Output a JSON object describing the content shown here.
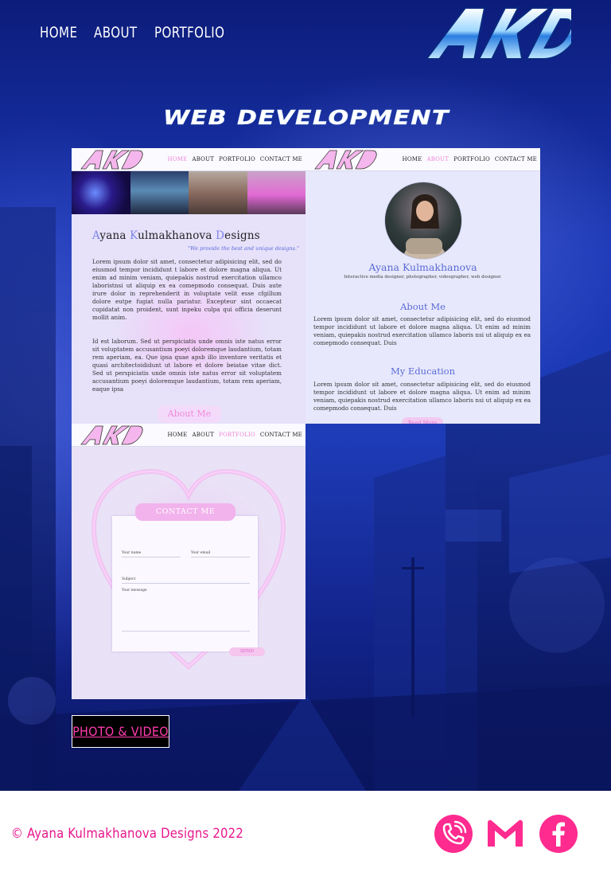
{
  "nav": {
    "items": [
      {
        "label": "HOME"
      },
      {
        "label": "ABOUT"
      },
      {
        "label": "PORTFOLIO"
      }
    ]
  },
  "logo": {
    "text": "AKD"
  },
  "section": {
    "title": "WEB DEVELOPMENT"
  },
  "thumbnails": {
    "home": {
      "nav": [
        "HOME",
        "ABOUT",
        "PORTFOLIO",
        "CONTACT ME"
      ],
      "active": "HOME",
      "title_parts": [
        "A",
        "yana ",
        "K",
        "ulmakhanova ",
        "D",
        "esigns"
      ],
      "tagline": "\"We provide the best and unique designs.\"",
      "para1": "Lorem ipsum dolor sit amet, consectetur adipisicing elit, sed do eiusmod tempor incididunt t labore et dolore magna aliqua. Ut enim ad minim veniam, quiepakis nostrud exercitation ullamco laboristnsi ut aliquip ex ea comepmodo consequat. Duis aute irure dolor in reprehenderit in voluptate velit esse cfgillum dolore eutpe fugiat nulla pariatur. Excepteur sint occaecat cupidatat non proident, sunt inpeku culpa qui officia deserunt mollit anim.",
      "para2": "Id est laborum. Sed ut perspiciatis unde omnis iste natus error sit voluptatem accusantium poeyi doloremque laudantium, totam rem aperiam, ea. Que ipsa quae apsb illo inventore veritatis et quasi architectoididunt ut labore et dolore beiatae vitae dict. Sed ut perspiciatis unde omnis iste natus error sit voluptatem accusantium poeyi doloremque laudantium, totam rem aperiam, eaque ipsa",
      "button": "About Me"
    },
    "about": {
      "nav": [
        "HOME",
        "ABOUT",
        "PORTFOLIO",
        "CONTACT ME"
      ],
      "active": "ABOUT",
      "name": "Ayana Kulmakhanova",
      "subtitle": "Interactive media designer, photographer, videographer, web designer.",
      "heading1": "About Me",
      "para1": "Lorem ipsum dolor sit amet, consectetur adipisicing elit, sed do eiusmod tempor incididunt ut labore et dolore magna aliqua. Ut enim ad minim veniam, quiepakis nostrud exercitation ullamco laboris nsi ut aliquip ex ea comepmodo consequat. Duis",
      "heading2": "My Education",
      "para2": "Lorem ipsum dolor sit amet, consectetur adipisicing elit, sed do eiusmod tempor incididunt ut labore et dolore magna aliqua. Ut enim ad minim veniam, quiepakis nostrud exercitation ullamco laboris nsi ut aliquip ex ea comepmodo consequat. Duis",
      "button": "Read More"
    },
    "contact": {
      "nav": [
        "HOME",
        "ABOUT",
        "PORTFOLIO",
        "CONTACT ME"
      ],
      "active": "PORTFOLIO",
      "title": "CONTACT ME",
      "name_placeholder": "Your name",
      "email_placeholder": "Your email",
      "subject_placeholder": "Subject",
      "message_placeholder": "Your message",
      "send": "SEND"
    }
  },
  "photo_video_button": "PHOTO & VIDEO",
  "footer": {
    "copyright": "© Ayana Kulmakhanova Designs 2022",
    "social": [
      {
        "icon": "phone-icon"
      },
      {
        "icon": "gmail-icon"
      },
      {
        "icon": "facebook-icon"
      }
    ]
  },
  "colors": {
    "accent_pink": "#e7178c",
    "social_pink": "#ff2b8f",
    "hero_blue": "#1a36b2",
    "button_text": "#ff3cae"
  }
}
